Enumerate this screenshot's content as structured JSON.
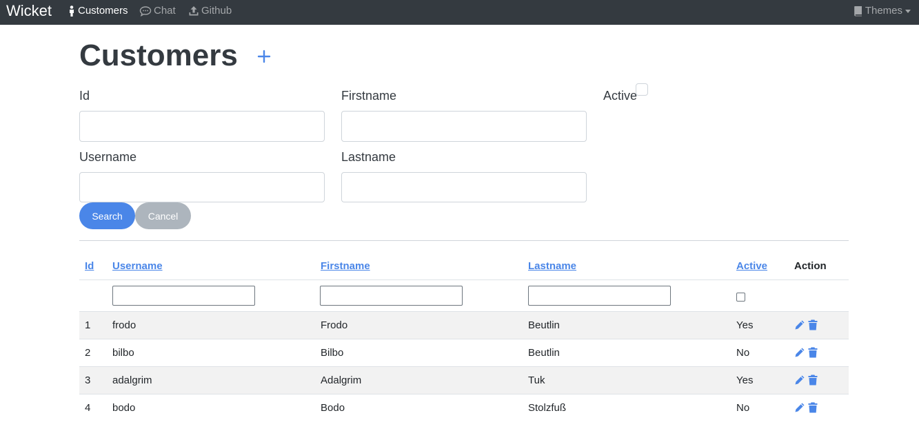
{
  "nav": {
    "brand": "Wicket",
    "customers": "Customers",
    "chat": "Chat",
    "github": "Github",
    "themes": "Themes"
  },
  "page": {
    "title": "Customers"
  },
  "form": {
    "id_label": "Id",
    "firstname_label": "Firstname",
    "active_label": "Active",
    "username_label": "Username",
    "lastname_label": "Lastname",
    "search_label": "Search",
    "cancel_label": "Cancel"
  },
  "table": {
    "headers": [
      "Id",
      "Username",
      "Firstname",
      "Lastname",
      "Active",
      "Action"
    ],
    "rows": [
      {
        "id": "1",
        "username": "frodo",
        "firstname": "Frodo",
        "lastname": "Beutlin",
        "active": "Yes"
      },
      {
        "id": "2",
        "username": "bilbo",
        "firstname": "Bilbo",
        "lastname": "Beutlin",
        "active": "No"
      },
      {
        "id": "3",
        "username": "adalgrim",
        "firstname": "Adalgrim",
        "lastname": "Tuk",
        "active": "Yes"
      },
      {
        "id": "4",
        "username": "bodo",
        "firstname": "Bodo",
        "lastname": "Stolzfuß",
        "active": "No"
      }
    ]
  },
  "colors": {
    "navbar": "#343a40",
    "accent": "#4a86e8",
    "cancel": "#adb5bd",
    "stripe": "#f2f2f2"
  },
  "icons": {
    "customers": "person-icon",
    "chat": "chat-bubble-icon",
    "github": "upload-icon",
    "themes": "book-icon",
    "add": "plus-icon",
    "edit": "pencil-icon",
    "delete": "trash-icon"
  }
}
